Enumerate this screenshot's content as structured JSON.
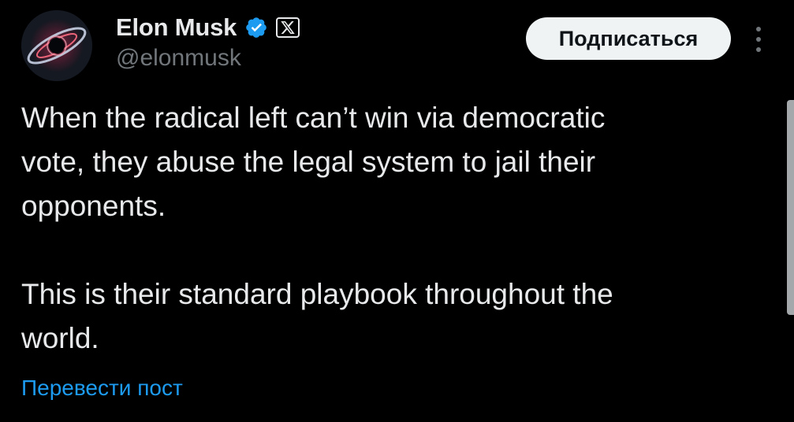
{
  "author": {
    "display_name": "Elon Musk",
    "handle": "@elonmusk",
    "verified_icon": "verified-badge-icon",
    "affiliate_icon": "x-logo-icon",
    "avatar_icon": "avatar-galaxy-image"
  },
  "header": {
    "follow_label": "Подписаться",
    "more_icon": "more-options-icon"
  },
  "tweet": {
    "text": "When the radical left can’t win via democratic\nvote, they abuse the legal system to jail their\nopponents.\n\nThis is their standard playbook throughout the\nworld.",
    "translate_label": "Перевести пост"
  },
  "colors": {
    "background": "#000000",
    "text_primary": "#e7e9ea",
    "text_secondary": "#71767b",
    "link": "#1d9bf0",
    "verified": "#1d9bf0",
    "button_bg": "#eff3f4",
    "button_text": "#0f1419"
  }
}
